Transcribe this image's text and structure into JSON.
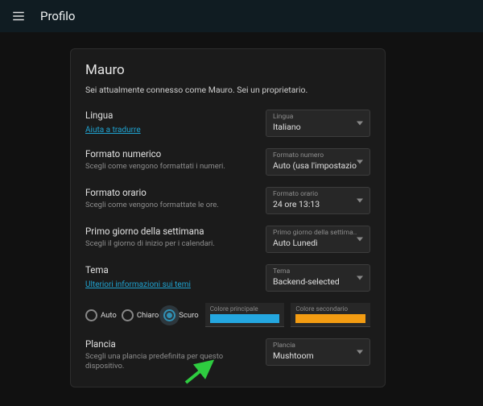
{
  "header": {
    "title": "Profilo"
  },
  "profile": {
    "name": "Mauro",
    "subtitle": "Sei attualmente connesso come Mauro. Sei un proprietario."
  },
  "language": {
    "title": "Lingua",
    "help_link": "Aiuta a tradurre",
    "select_label": "Lingua",
    "select_value": "Italiano"
  },
  "number_format": {
    "title": "Formato numerico",
    "desc": "Scegli come vengono formattati i numeri.",
    "select_label": "Formato numero",
    "select_value": "Auto (usa l'impostazio"
  },
  "time_format": {
    "title": "Formato orario",
    "desc": "Scegli come vengono formattate le ore.",
    "select_label": "Formato orario",
    "select_value": "24 ore 13:13"
  },
  "first_day": {
    "title": "Primo giorno della settimana",
    "desc": "Scegli il giorno di inizio per i calendari.",
    "select_label": "Primo giorno della settima..",
    "select_value": "Auto Lunedì"
  },
  "theme": {
    "title": "Tema",
    "link": "Ulteriori informazioni sui temi",
    "select_label": "Tema",
    "select_value": "Backend-selected",
    "options": {
      "auto": "Auto",
      "light": "Chiaro",
      "dark": "Scuro"
    },
    "primary_label": "Colore principale",
    "secondary_label": "Colore secondario",
    "primary_color": "#24a7e0",
    "secondary_color": "#f39c12"
  },
  "dashboard": {
    "title": "Plancia",
    "desc": "Scegli una plancia predefinita per questo dispositivo.",
    "select_label": "Plancia",
    "select_value": "Mushtoom"
  }
}
